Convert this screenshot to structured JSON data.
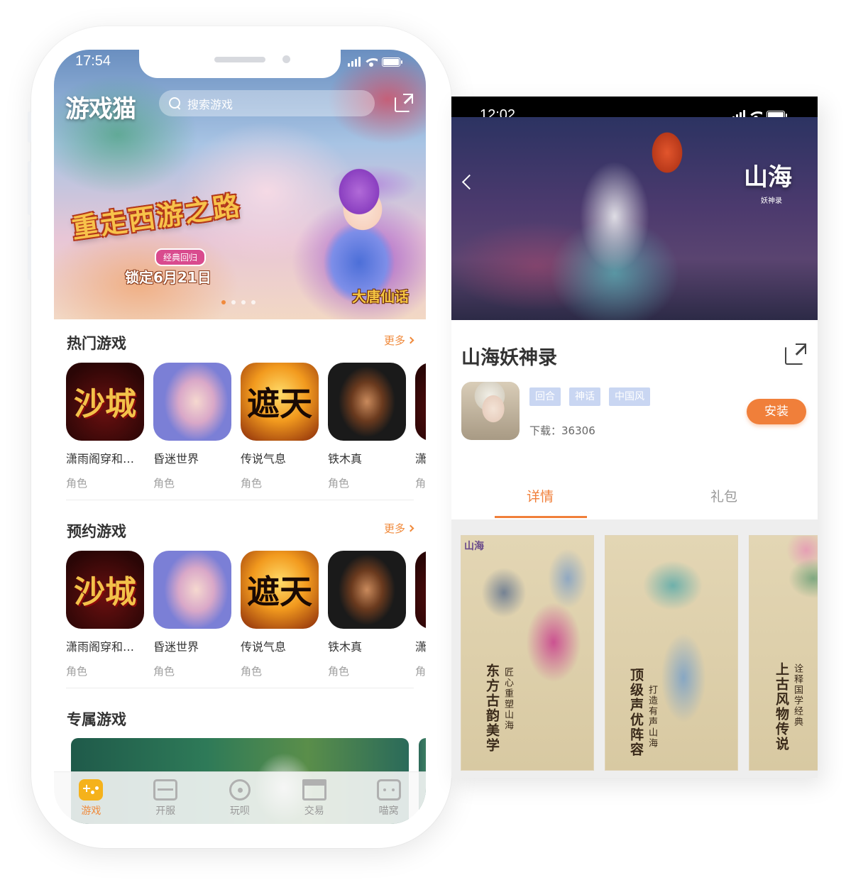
{
  "left_phone": {
    "status": {
      "time": "17:54"
    },
    "header": {
      "logo": "游戏猫",
      "search_placeholder": "搜索游戏"
    },
    "banner": {
      "title": "重走西游之路",
      "subtitle": "经典回归",
      "date": "锁定6月21日",
      "brand": "大唐仙话",
      "slides": 4,
      "active_slide": 0
    },
    "sections": {
      "hot": {
        "title": "热门游戏",
        "more": "更多"
      },
      "reserve": {
        "title": "预约游戏",
        "more": "更多"
      },
      "exclusive": {
        "title": "专属游戏"
      }
    },
    "hot_games": [
      {
        "name": "潇雨阁穿和欲...",
        "category": "角色",
        "glyph": "沙城"
      },
      {
        "name": "昏迷世界",
        "category": "角色",
        "glyph": ""
      },
      {
        "name": "传说气息",
        "category": "角色",
        "glyph": "遮天"
      },
      {
        "name": "铁木真",
        "category": "角色",
        "glyph": ""
      },
      {
        "name": "潇",
        "category": "角",
        "glyph": "沙"
      }
    ],
    "reserve_games": [
      {
        "name": "潇雨阁穿和欲...",
        "category": "角色",
        "glyph": "沙城"
      },
      {
        "name": "昏迷世界",
        "category": "角色",
        "glyph": ""
      },
      {
        "name": "传说气息",
        "category": "角色",
        "glyph": "遮天"
      },
      {
        "name": "铁木真",
        "category": "角色",
        "glyph": ""
      },
      {
        "name": "潇",
        "category": "角",
        "glyph": "沙"
      }
    ],
    "tabbar": [
      {
        "label": "游戏",
        "icon": "gamepad-icon",
        "active": true
      },
      {
        "label": "开服",
        "icon": "calendar-icon",
        "active": false
      },
      {
        "label": "玩呗",
        "icon": "paw-icon",
        "active": false
      },
      {
        "label": "交易",
        "icon": "shop-icon",
        "active": false
      },
      {
        "label": "喵窝",
        "icon": "cat-icon",
        "active": false
      }
    ]
  },
  "right_phone": {
    "status": {
      "time": "12:02"
    },
    "hero": {
      "logo": "山海",
      "logo_sub": "妖神录"
    },
    "game": {
      "title": "山海妖神录",
      "tags": [
        "回合",
        "神话",
        "中国风"
      ],
      "downloads_label": "下载：",
      "downloads": "36306",
      "install_label": "安装"
    },
    "tabs": [
      {
        "label": "详情",
        "active": true
      },
      {
        "label": "礼包",
        "active": false
      }
    ],
    "screenshots": [
      {
        "caption_main": "东方古韵美学",
        "caption_sub": "匠心重塑山海"
      },
      {
        "caption_main": "顶级声优阵容",
        "caption_sub": "打造有声山海"
      },
      {
        "caption_main": "上古风物传说",
        "caption_sub": "诠释国学经典"
      }
    ]
  },
  "colors": {
    "accent": "#f08a3c",
    "tag_bg": "#c9d6f2",
    "install_bg": "#f07f3a"
  }
}
